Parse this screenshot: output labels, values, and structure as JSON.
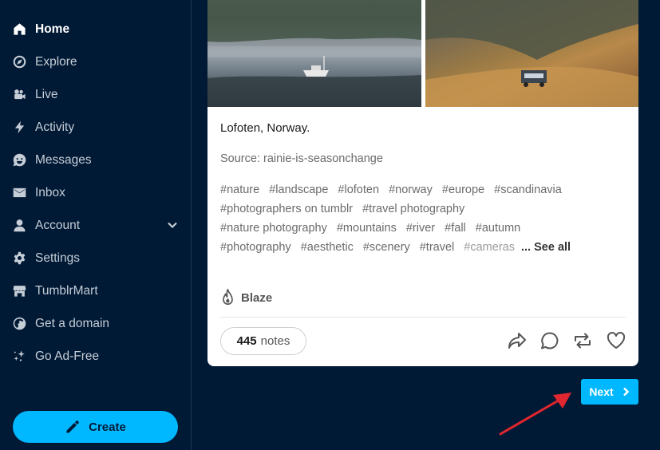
{
  "sidebar": {
    "items": [
      {
        "label": "Home",
        "icon": "home-icon"
      },
      {
        "label": "Explore",
        "icon": "compass-icon"
      },
      {
        "label": "Live",
        "icon": "video-camera-icon"
      },
      {
        "label": "Activity",
        "icon": "lightning-icon"
      },
      {
        "label": "Messages",
        "icon": "smiley-chat-icon"
      },
      {
        "label": "Inbox",
        "icon": "envelope-icon"
      },
      {
        "label": "Account",
        "icon": "person-icon"
      },
      {
        "label": "Settings",
        "icon": "gear-icon"
      },
      {
        "label": "TumblrMart",
        "icon": "storefront-icon"
      },
      {
        "label": "Get a domain",
        "icon": "globe-icon"
      },
      {
        "label": "Go Ad-Free",
        "icon": "sparkles-icon"
      }
    ],
    "active": "Home",
    "create_label": "Create"
  },
  "post": {
    "caption": "Lofoten, Norway.",
    "source": "Source: rainie-is-seasonchange",
    "tag_lines": [
      [
        "#nature",
        "#landscape",
        "#lofoten",
        "#norway",
        "#europe",
        "#scandinavia"
      ],
      [
        "#photographers on tumblr",
        "#travel photography"
      ],
      [
        "#nature photography",
        "#mountains",
        "#river",
        "#fall",
        "#autumn"
      ],
      [
        "#photography",
        "#aesthetic",
        "#scenery",
        "#travel",
        "#cameras"
      ]
    ],
    "see_all": "... See all",
    "blaze_label": "Blaze",
    "notes_count": "445",
    "notes_label": "notes"
  },
  "pagination": {
    "next_label": "Next"
  },
  "colors": {
    "background": "#001935",
    "accent": "#00b8ff",
    "annotation_arrow": "#e0262e"
  }
}
